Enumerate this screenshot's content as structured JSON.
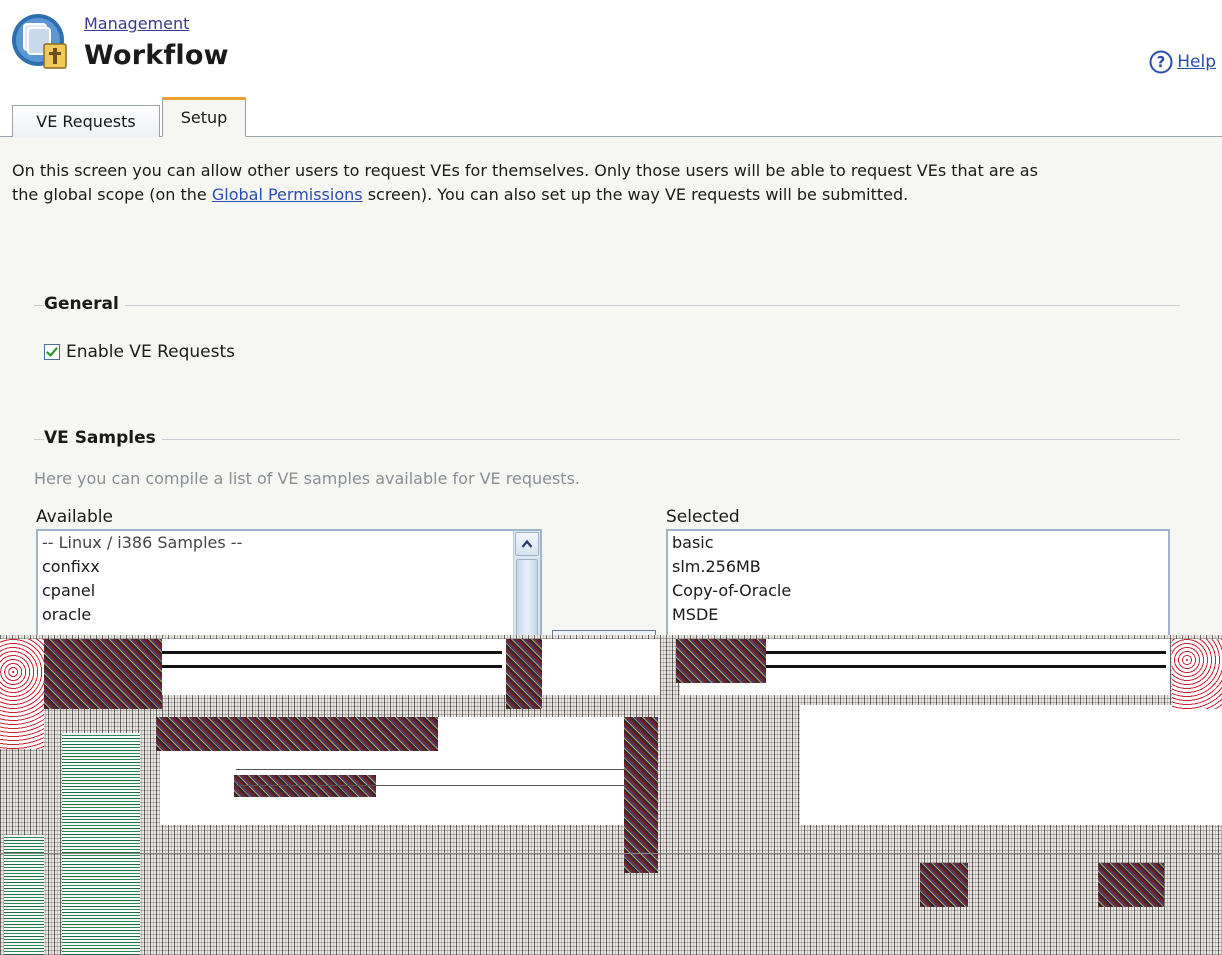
{
  "header": {
    "breadcrumb": "Management",
    "title": "Workflow",
    "help_label": "Help"
  },
  "tabs": [
    {
      "label": "VE Requests",
      "active": false
    },
    {
      "label": "Setup",
      "active": true
    }
  ],
  "intro": {
    "line1": "On this screen you can allow other users to request VEs for themselves. Only those users will be able to request VEs that are as",
    "line2_prefix": "the global scope (on the ",
    "link": "Global Permissions",
    "line2_suffix": " screen). You can also set up the way VE requests will be submitted."
  },
  "general": {
    "title": "General",
    "enable_label": "Enable VE Requests",
    "enable_checked": true
  },
  "samples": {
    "title": "VE Samples",
    "hint": "Here you can compile a list of VE samples available for VE requests.",
    "available_label": "Available",
    "selected_label": "Selected",
    "available_items": [
      "-- Linux / i386 Samples --",
      "confixx",
      "cpanel",
      "oracle"
    ],
    "selected_items": [
      "basic",
      "slm.256MB",
      "Copy-of-Oracle",
      "MSDE"
    ]
  },
  "colors": {
    "accent_tab": "#f0a030",
    "link": "#2a4db0",
    "panel_bg": "#f6f6f3",
    "checkbox_check": "#2a9a2a"
  },
  "icons": {
    "app": "workflow-app-icon",
    "help": "help-circle-icon",
    "check": "checkmark-icon",
    "scroll_up": "chevron-up-icon"
  }
}
